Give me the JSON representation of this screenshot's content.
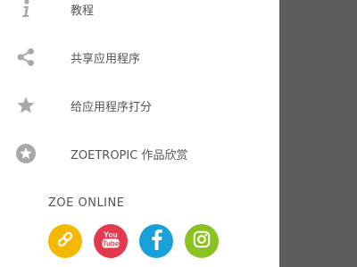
{
  "menu": {
    "items": [
      {
        "id": "tutorial",
        "label": "教程",
        "icon": "info-icon"
      },
      {
        "id": "share",
        "label": "共享应用程序",
        "icon": "share-icon"
      },
      {
        "id": "rate",
        "label": "给应用程序打分",
        "icon": "star-icon"
      },
      {
        "id": "showcase",
        "label": "ZOETROPIC 作品欣赏",
        "icon": "star-circle-icon"
      }
    ]
  },
  "online": {
    "title": "ZOE ONLINE",
    "links": [
      {
        "id": "website",
        "icon": "link-icon",
        "color": "#f5b800"
      },
      {
        "id": "youtube",
        "icon": "youtube-icon",
        "text": "You Tube",
        "color": "#e23a4c"
      },
      {
        "id": "facebook",
        "icon": "facebook-icon",
        "text": "f",
        "color": "#1aa0d8"
      },
      {
        "id": "instagram",
        "icon": "instagram-icon",
        "color": "#8ac220"
      }
    ]
  },
  "colors": {
    "icon_gray": "#a8a8a8",
    "text_gray": "#555555",
    "overlay": "#5c5c5c"
  }
}
